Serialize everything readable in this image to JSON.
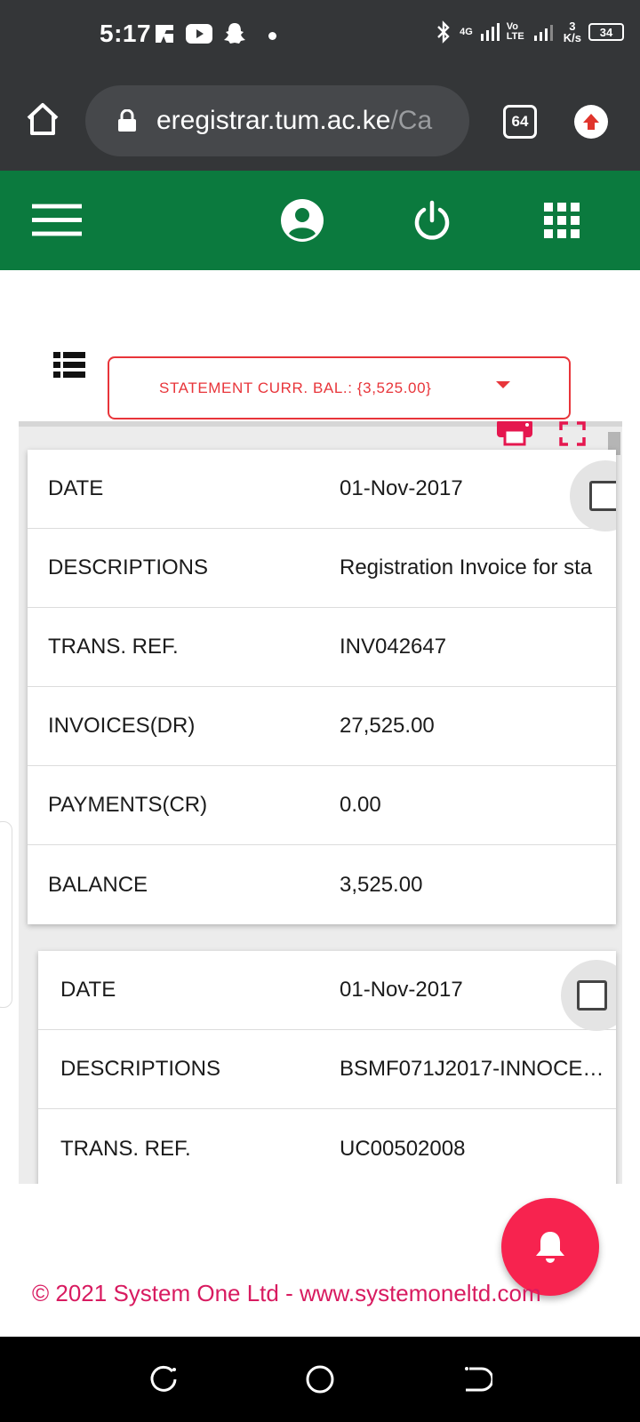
{
  "status_bar": {
    "time": "5:17",
    "network": "4G",
    "volte": "Vo LTE",
    "speed_value": "3",
    "speed_unit": "K/s",
    "battery": "34"
  },
  "browser": {
    "url_main": "eregistrar.tum.ac.ke",
    "url_rest": "/Ca",
    "tab_count": "64"
  },
  "statement": {
    "dropdown_label": "STATEMENT CURR. BAL.: {3,525.00}"
  },
  "records": [
    {
      "rows": [
        {
          "label": "DATE",
          "value": "01-Nov-2017"
        },
        {
          "label": "DESCRIPTIONS",
          "value": "Registration Invoice for sta"
        },
        {
          "label": "TRANS. REF.",
          "value": "INV042647"
        },
        {
          "label": "INVOICES(DR)",
          "value": "27,525.00"
        },
        {
          "label": "PAYMENTS(CR)",
          "value": "0.00"
        },
        {
          "label": "BALANCE",
          "value": "3,525.00"
        }
      ]
    },
    {
      "rows": [
        {
          "label": "DATE",
          "value": "01-Nov-2017"
        },
        {
          "label": "DESCRIPTIONS",
          "value": "BSMF071J2017-INNOCE…"
        },
        {
          "label": "TRANS. REF.",
          "value": "UC00502008"
        }
      ]
    }
  ],
  "footer": {
    "copyright": "© 2021 System One Ltd - www.systemoneltd.com"
  },
  "colors": {
    "status_bg": "#343638",
    "app_green": "#0b7a3e",
    "accent_red": "#e8353a",
    "fab_pink": "#f7234f",
    "footer_pink": "#d81b60"
  }
}
